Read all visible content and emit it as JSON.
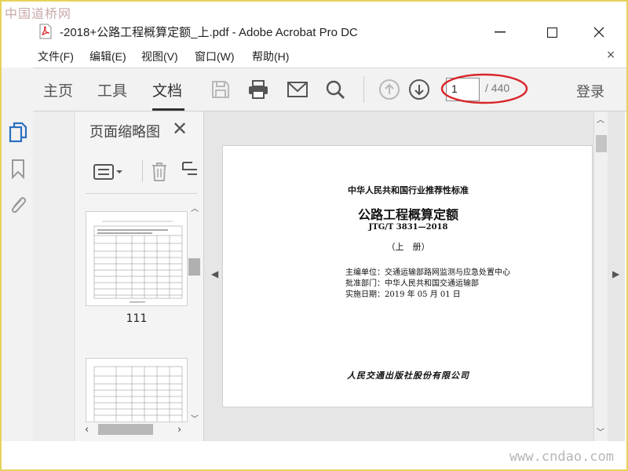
{
  "watermark": {
    "top": "中国道桥网",
    "bottom": "www.cndao.com"
  },
  "window": {
    "title": "-2018+公路工程概算定额_上.pdf - Adobe Acrobat Pro DC",
    "min": "—",
    "max": "☐",
    "close": "✕"
  },
  "menu": {
    "items": [
      "文件(F)",
      "编辑(E)",
      "视图(V)",
      "窗口(W)",
      "帮助(H)"
    ],
    "close": "×"
  },
  "toolbar": {
    "tabs": [
      "主页",
      "工具",
      "文档"
    ],
    "active_tab": "文档",
    "page_current": "1",
    "page_total": "/ 440",
    "login": "登录",
    "icons": [
      "save-icon",
      "print-icon",
      "email-icon",
      "search-icon",
      "page-up-icon",
      "page-down-icon"
    ]
  },
  "thumb_panel": {
    "title": "页面缩略图",
    "close": "✕",
    "thumbs": [
      {
        "label": "111"
      }
    ]
  },
  "document": {
    "standard": "中华人民共和国行业推荐性标准",
    "title": "公路工程概算定额",
    "code": "JTG/T 3831—2018",
    "volume": "（上　册）",
    "editor": "主编单位：交通运输部路网监测与应急处置中心",
    "approver": "批准部门：中华人民共和国交通运输部",
    "date": "实施日期：2019 年 05 月 01 日",
    "publisher": "人民交通出版社股份有限公司"
  },
  "colors": {
    "accent": "#2b6fc0",
    "annotation": "#d9262b",
    "panel_bg": "#f4f4f4"
  }
}
